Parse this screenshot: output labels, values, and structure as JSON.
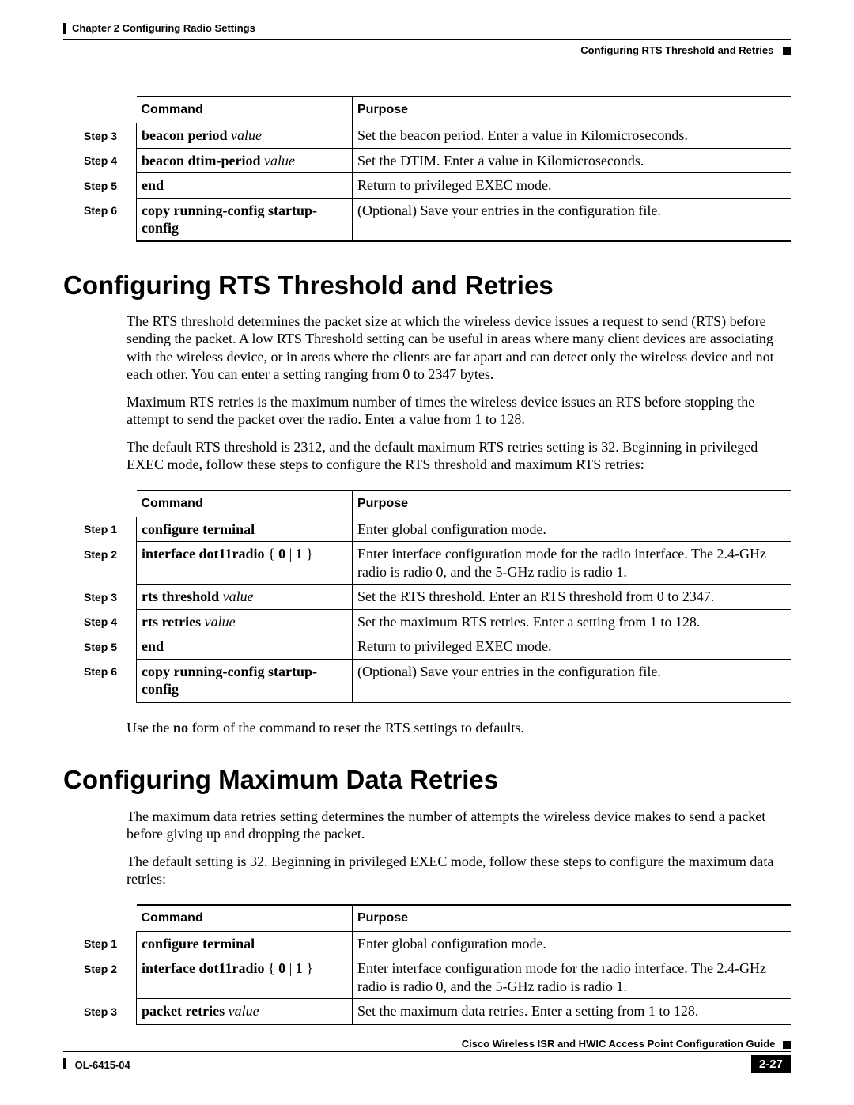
{
  "header": {
    "chapter": "Chapter 2      Configuring Radio Settings",
    "section": "Configuring RTS Threshold and Retries"
  },
  "tableLabels": {
    "command": "Command",
    "purpose": "Purpose"
  },
  "table1": {
    "rows": [
      {
        "step": "Step 3",
        "cmd_html": "<span class='b'>beacon period</span> <span class='i'>value</span>",
        "purp": "Set the beacon period. Enter a value in Kilomicroseconds."
      },
      {
        "step": "Step 4",
        "cmd_html": "<span class='b'>beacon dtim-period</span> <span class='i'>value</span>",
        "purp": "Set the DTIM. Enter a value in Kilomicroseconds."
      },
      {
        "step": "Step 5",
        "cmd_html": "<span class='b'>end</span>",
        "purp": "Return to privileged EXEC mode."
      },
      {
        "step": "Step 6",
        "cmd_html": "<span class='b'>copy running-config startup-config</span>",
        "purp": "(Optional) Save your entries in the configuration file."
      }
    ]
  },
  "sec1": {
    "title": "Configuring RTS Threshold and Retries",
    "p1": "The RTS threshold determines the packet size at which the wireless device issues a request to send (RTS) before sending the packet. A low RTS Threshold setting can be useful in areas where many client devices are associating with the wireless device, or in areas where the clients are far apart and can detect only the wireless device and not each other. You can enter a setting ranging from 0 to 2347 bytes.",
    "p2": "Maximum RTS retries is the maximum number of times the wireless device issues an RTS before stopping the attempt to send the packet over the radio. Enter a value from 1 to 128.",
    "p3": "The default RTS threshold is 2312, and the default maximum RTS retries setting is 32. Beginning in privileged EXEC mode, follow these steps to configure the RTS threshold and maximum RTS retries:",
    "rows": [
      {
        "step": "Step 1",
        "cmd_html": "<span class='b'>configure terminal</span>",
        "purp": "Enter global configuration mode."
      },
      {
        "step": "Step 2",
        "cmd_html": "<span class='b'>interface dot11radio</span> { <span class='b'>0</span> | <span class='b'>1</span> }",
        "purp": "Enter interface configuration mode for the radio interface. The 2.4-GHz radio is radio 0, and the 5-GHz radio is radio 1."
      },
      {
        "step": "Step 3",
        "cmd_html": "<span class='b'>rts threshold</span> <span class='i'>value</span>",
        "purp": "Set the RTS threshold. Enter an RTS threshold from 0 to 2347."
      },
      {
        "step": "Step 4",
        "cmd_html": "<span class='b'>rts retries</span> <span class='i'>value</span>",
        "purp": "Set the maximum RTS retries. Enter a setting from 1 to 128."
      },
      {
        "step": "Step 5",
        "cmd_html": "<span class='b'>end</span>",
        "purp": "Return to privileged EXEC mode."
      },
      {
        "step": "Step 6",
        "cmd_html": "<span class='b'>copy running-config startup-config</span>",
        "purp": "(Optional) Save your entries in the configuration file."
      }
    ],
    "after_html": "Use the <span class='b'>no</span> form of the command to reset the RTS settings to defaults."
  },
  "sec2": {
    "title": "Configuring Maximum Data Retries",
    "p1": "The maximum data retries setting determines the number of attempts the wireless device makes to send a packet before giving up and dropping the packet.",
    "p2": "The default setting is 32. Beginning in privileged EXEC mode, follow these steps to configure the maximum data retries:",
    "rows": [
      {
        "step": "Step 1",
        "cmd_html": "<span class='b'>configure terminal</span>",
        "purp": "Enter global configuration mode."
      },
      {
        "step": "Step 2",
        "cmd_html": "<span class='b'>interface dot11radio</span> { <span class='b'>0</span> | <span class='b'>1</span> }",
        "purp": "Enter interface configuration mode for the radio interface. The 2.4-GHz radio is radio 0, and the 5-GHz radio is radio 1."
      },
      {
        "step": "Step 3",
        "cmd_html": "<span class='b'>packet retries</span> <span class='i'>value</span>",
        "purp": "Set the maximum data retries. Enter a setting from 1 to 128."
      }
    ]
  },
  "footer": {
    "title": "Cisco Wireless ISR and HWIC Access Point Configuration Guide",
    "ol": "OL-6415-04",
    "page": "2-27"
  }
}
